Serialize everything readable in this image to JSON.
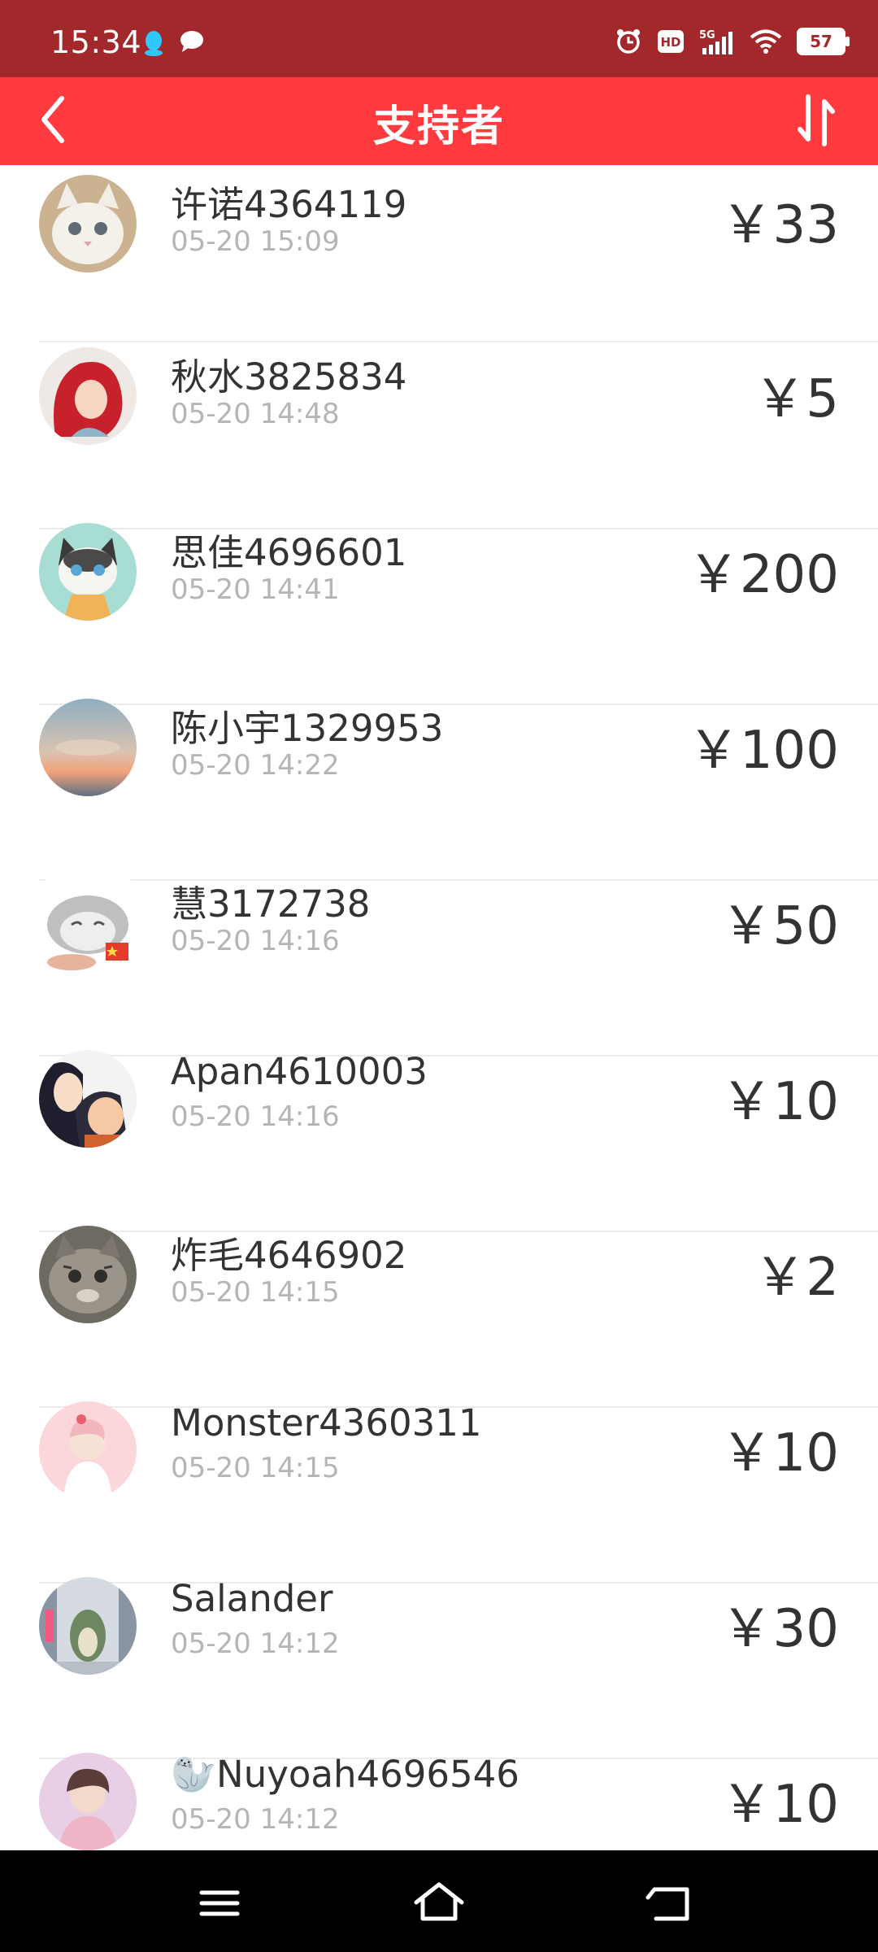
{
  "status_bar": {
    "time": "15:34",
    "battery": "57",
    "icons": [
      "qq-icon",
      "chat-bubble-icon",
      "alarm-icon",
      "hd-icon",
      "5g-signal-icon",
      "wifi-icon",
      "battery-icon"
    ]
  },
  "header": {
    "title": "支持者",
    "back_icon": "chevron-left-icon",
    "sort_icon": "sort-arrows-icon",
    "background": "#ff3b3f"
  },
  "supporters": [
    {
      "name": "许诺4364119",
      "time": "05-20 15:09",
      "amount": "￥33",
      "avatar": "white-kitten"
    },
    {
      "name": "秋水3825834",
      "time": "05-20 14:48",
      "amount": "￥5",
      "avatar": "red-hair-mermaid"
    },
    {
      "name": "思佳4696601",
      "time": "05-20 14:41",
      "amount": "￥200",
      "avatar": "cartoon-cat"
    },
    {
      "name": "陈小宇1329953",
      "time": "05-20 14:22",
      "amount": "￥100",
      "avatar": "sunset-sky"
    },
    {
      "name": "慧3172738",
      "time": "05-20 14:16",
      "amount": "￥50",
      "avatar": "sleeping-cat"
    },
    {
      "name": "Apan4610003",
      "time": "05-20 14:16",
      "amount": "￥10",
      "avatar": "cartoon-couple"
    },
    {
      "name": "炸毛4646902",
      "time": "05-20 14:15",
      "amount": "￥2",
      "avatar": "tabby-cat"
    },
    {
      "name": "Monster4360311",
      "time": "05-20 14:15",
      "amount": "￥10",
      "avatar": "pink-girl"
    },
    {
      "name": "Salander",
      "time": "05-20 14:12",
      "amount": "￥30",
      "avatar": "subway-totoro"
    },
    {
      "name": "🦭Nuyoah4696546",
      "time": "05-20 14:12",
      "amount": "￥10",
      "avatar": "pink-portrait"
    }
  ],
  "nav_bar": {
    "menu_icon": "menu-icon",
    "home_icon": "home-icon",
    "back_icon": "back-icon"
  }
}
